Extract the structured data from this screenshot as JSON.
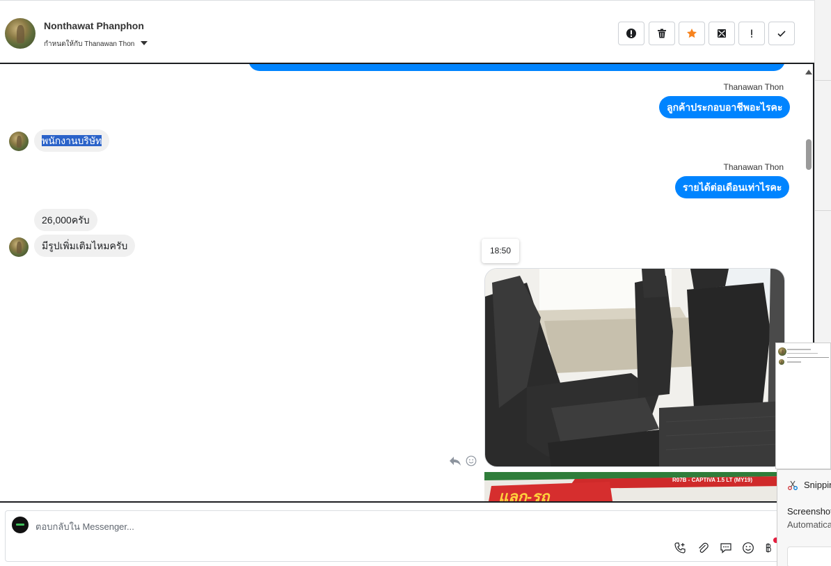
{
  "header": {
    "contact_name": "Nonthawat Phanphon",
    "assigned_label": "กำหนดให้กับ Thanawan Thon",
    "toolbar": [
      {
        "name": "spam",
        "icon": "alert-circle-icon"
      },
      {
        "name": "delete",
        "icon": "trash-icon"
      },
      {
        "name": "star",
        "icon": "star-icon"
      },
      {
        "name": "mark-unread",
        "icon": "mail-icon"
      },
      {
        "name": "priority",
        "icon": "exclamation-icon"
      },
      {
        "name": "done",
        "icon": "check-icon"
      }
    ]
  },
  "messages": {
    "sender_1": "Thanawan Thon",
    "out_1": "ลูกค้าประกอบอาชีพอะไรคะ",
    "in_1": "พนักงานบริษัท",
    "sender_2": "Thanawan Thon",
    "out_2": "รายได้ต่อเดือนเท่าไรคะ",
    "in_2": "26,000ครับ",
    "in_3": "มีรูปเพิ่มเติมไหมครับ",
    "timestamp": "18:50",
    "banner_text": "แลก-รถ",
    "banner_model": "R07B - CAPTIVA 1.5 LT (MY19)"
  },
  "composer": {
    "placeholder": "ตอบกลับใน Messenger..."
  },
  "snipping": {
    "app_name": "Snipping Tool",
    "title": "Screenshot copied",
    "subtitle": "Automatically saved"
  },
  "colors": {
    "accent_blue": "#0084ff",
    "star_orange": "#f7831e",
    "selection": "#2b63c9"
  }
}
